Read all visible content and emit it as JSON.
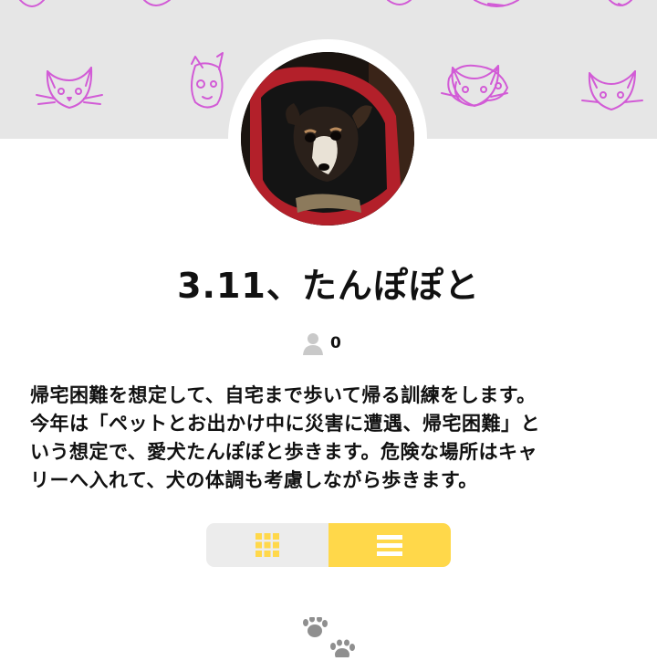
{
  "header": {
    "background_color": "#e6e6e6",
    "doodle_color": "#d25bd6",
    "doodle_icons": [
      "cat-doodle-icon",
      "dog-doodle-icon",
      "cat-doodle-icon",
      "dog-doodle-icon",
      "cat-doodle-icon"
    ]
  },
  "profile": {
    "avatar_icon": "dog-photo-avatar",
    "title": "3.11、たんぽぽと",
    "follower_icon": "person-icon",
    "follower_count": "0",
    "description": "帰宅困難を想定して、自宅まで歩いて帰る訓練をします。\n今年は「ペットとお出かけ中に災害に遭遇、帰宅困難」と\nいう想定で、愛犬たんぽぽと歩きます。危険な場所はキャ\nリーへ入れて、犬の体調も考慮しながら歩きます。"
  },
  "view_toggle": {
    "options": [
      {
        "icon": "grid-icon",
        "selected": false
      },
      {
        "icon": "list-icon",
        "selected": true
      }
    ],
    "accent_color": "#ffd84a"
  },
  "footer": {
    "icon": "paw-prints-icon"
  }
}
